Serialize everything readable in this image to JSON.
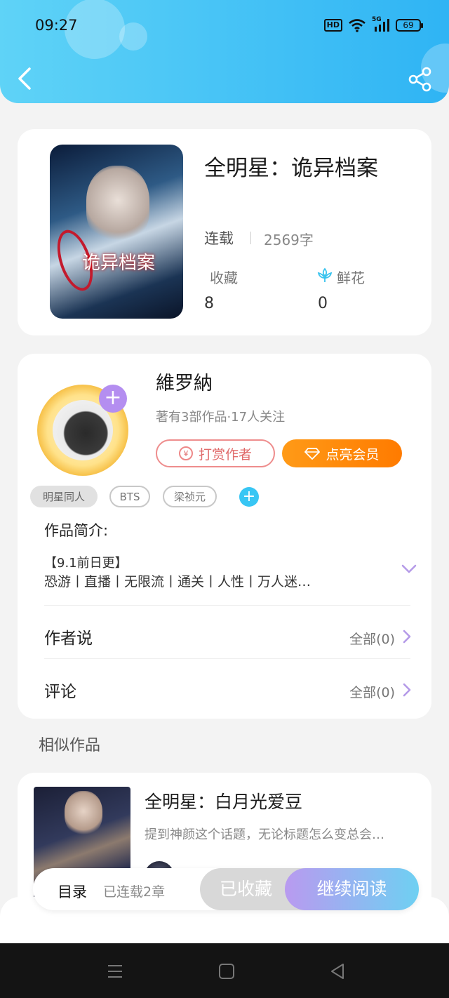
{
  "status_bar": {
    "time": "09:27",
    "hd": "HD",
    "network": "5G",
    "battery": "69"
  },
  "header": {
    "back_icon": "chevron-left-icon",
    "share_icon": "share-icon",
    "gradient": [
      "#5fd3f7",
      "#2fb4f4"
    ]
  },
  "book": {
    "title": "全明星：诡异档案",
    "cover_title": "诡异档案",
    "status": "连载",
    "word_count": "2569字",
    "collect_label": "收藏",
    "collect_value": "8",
    "flower_label": "鲜花",
    "flower_value": "0"
  },
  "author": {
    "name": "維罗納",
    "meta": "著有3部作品·17人关注",
    "reward_label": "打赏作者",
    "vip_label": "点亮会员",
    "tags": [
      "明星同人",
      "BTS",
      "梁祯元"
    ],
    "intro_label": "作品简介:",
    "intro_line1": "【9.1前日更】",
    "intro_line2": "恐游丨直播丨无限流丨通关丨人性丨万人迷…",
    "author_says_label": "作者说",
    "author_says_value": "全部(0)",
    "comments_label": "评论",
    "comments_value": "全部(0)"
  },
  "similar": {
    "section_title": "相似作品",
    "items": [
      {
        "title": "全明星：白月光爱豆",
        "desc": "提到神颜这个话题，无论标题怎么变总会…"
      }
    ]
  },
  "action_bar": {
    "toc_label": "目录",
    "toc_meta": "已连载2章",
    "collected_label": "已收藏",
    "read_label": "继续阅读"
  },
  "colors": {
    "accent_purple": "#b48ef0",
    "accent_blue": "#38c6f4",
    "vip_orange": "#ff8a0c",
    "reward_red": "#e06b6b"
  }
}
